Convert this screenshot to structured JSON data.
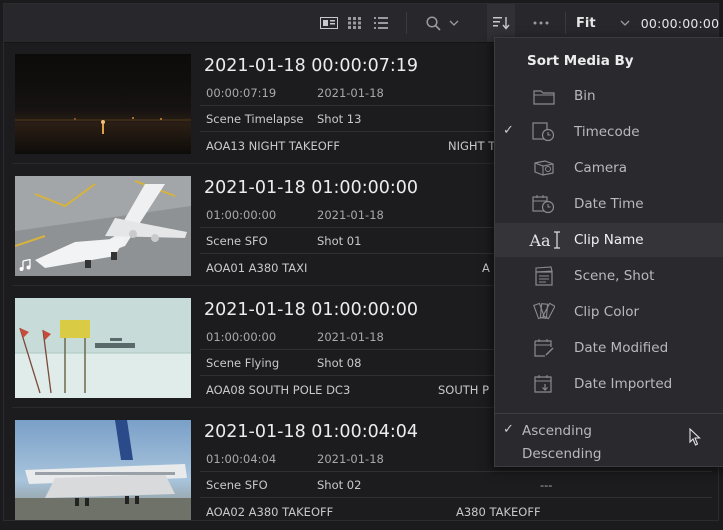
{
  "toolbar": {
    "zoom": "Fit",
    "timecode": "00:00:00:00"
  },
  "clips": [
    {
      "title": "2021-01-18  00:00:07:19",
      "timecode": "00:00:07:19",
      "date": "2021-01-18",
      "scene": "Scene Timelapse",
      "shot": "Shot 13",
      "name": "AOA13 NIGHT TAKEOFF",
      "tag": "NIGHT T"
    },
    {
      "title": "2021-01-18  01:00:00:00",
      "timecode": "01:00:00:00",
      "date": "2021-01-18",
      "scene": "Scene SFO",
      "shot": "Shot 01",
      "name": "AOA01 A380 TAXI",
      "tag": "A"
    },
    {
      "title": "2021-01-18  01:00:00:00",
      "timecode": "01:00:00:00",
      "date": "2021-01-18",
      "scene": "Scene Flying",
      "shot": "Shot 08",
      "name": "AOA08 SOUTH POLE DC3",
      "tag": "SOUTH P"
    },
    {
      "title": "2021-01-18  01:00:04:04",
      "timecode": "01:00:04:04",
      "date": "2021-01-18",
      "scene": "Scene SFO",
      "shot": "Shot 02",
      "name": "AOA02 A380 TAKEOFF",
      "tag": "A380 TAKEOFF",
      "dash": "---"
    }
  ],
  "sort_menu": {
    "title": "Sort Media By",
    "items": [
      {
        "label": "Bin",
        "icon": "folder-icon",
        "checked": false
      },
      {
        "label": "Timecode",
        "icon": "timecode-icon",
        "checked": true
      },
      {
        "label": "Camera",
        "icon": "camera-icon",
        "checked": false
      },
      {
        "label": "Date Time",
        "icon": "calendar-clock-icon",
        "checked": false
      },
      {
        "label": "Clip Name",
        "icon": "text-cursor-icon",
        "checked": false,
        "hovered": true
      },
      {
        "label": "Scene, Shot",
        "icon": "clapperboard-icon",
        "checked": false
      },
      {
        "label": "Clip Color",
        "icon": "color-swatch-icon",
        "checked": false
      },
      {
        "label": "Date Modified",
        "icon": "date-modified-icon",
        "checked": false
      },
      {
        "label": "Date Imported",
        "icon": "date-imported-icon",
        "checked": false
      }
    ],
    "ascending": "Ascending",
    "descending": "Descending",
    "ascending_checked": true,
    "check_glyph": "✓",
    "clip_name_icon_text": "Aa"
  }
}
